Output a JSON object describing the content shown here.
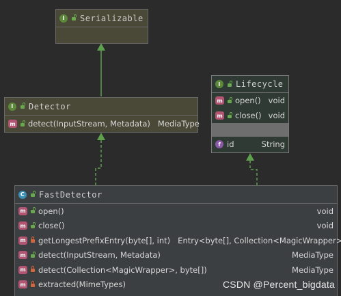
{
  "serializable": {
    "name": "Serializable"
  },
  "detector": {
    "name": "Detector",
    "methods": [
      {
        "name": "detect(InputStream, Metadata)",
        "ret": "MediaType"
      }
    ]
  },
  "lifecycle": {
    "name": "Lifecycle",
    "methods": [
      {
        "name": "open()",
        "ret": "void"
      },
      {
        "name": "close()",
        "ret": "void"
      }
    ],
    "fields": [
      {
        "name": "id",
        "ret": "String"
      }
    ]
  },
  "fastdetector": {
    "name": "FastDetector",
    "methods": [
      {
        "name": "open()",
        "ret": "void"
      },
      {
        "name": "close()",
        "ret": "void"
      },
      {
        "name": "getLongestPrefixEntry(byte[], int)",
        "ret": "Entry<byte[], Collection<MagicWrapper>>"
      },
      {
        "name": "detect(InputStream, Metadata)",
        "ret": "MediaType"
      },
      {
        "name": "detect(Collection<MagicWrapper>, byte[])",
        "ret": "MediaType"
      },
      {
        "name": "extracted(MimeTypes)",
        "ret": ""
      }
    ]
  },
  "badges": {
    "interface": "I",
    "class": "C",
    "method": "m",
    "field": "f"
  },
  "colors": {
    "background": "#2b2b2b",
    "interface": "#4a4937",
    "class": "#3c3f41",
    "edge": "#5fa04e"
  },
  "watermark": "CSDN @Percent_bigdata"
}
